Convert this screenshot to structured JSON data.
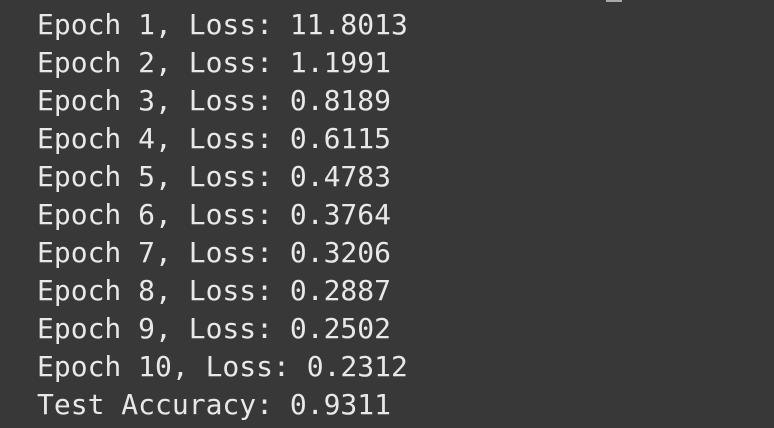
{
  "output": {
    "lines": [
      "Epoch 1, Loss: 11.8013",
      "Epoch 2, Loss: 1.1991",
      "Epoch 3, Loss: 0.8189",
      "Epoch 4, Loss: 0.6115",
      "Epoch 5, Loss: 0.4783",
      "Epoch 6, Loss: 0.3764",
      "Epoch 7, Loss: 0.3206",
      "Epoch 8, Loss: 0.2887",
      "Epoch 9, Loss: 0.2502",
      "Epoch 10, Loss: 0.2312",
      "Test Accuracy: 0.9311"
    ]
  }
}
